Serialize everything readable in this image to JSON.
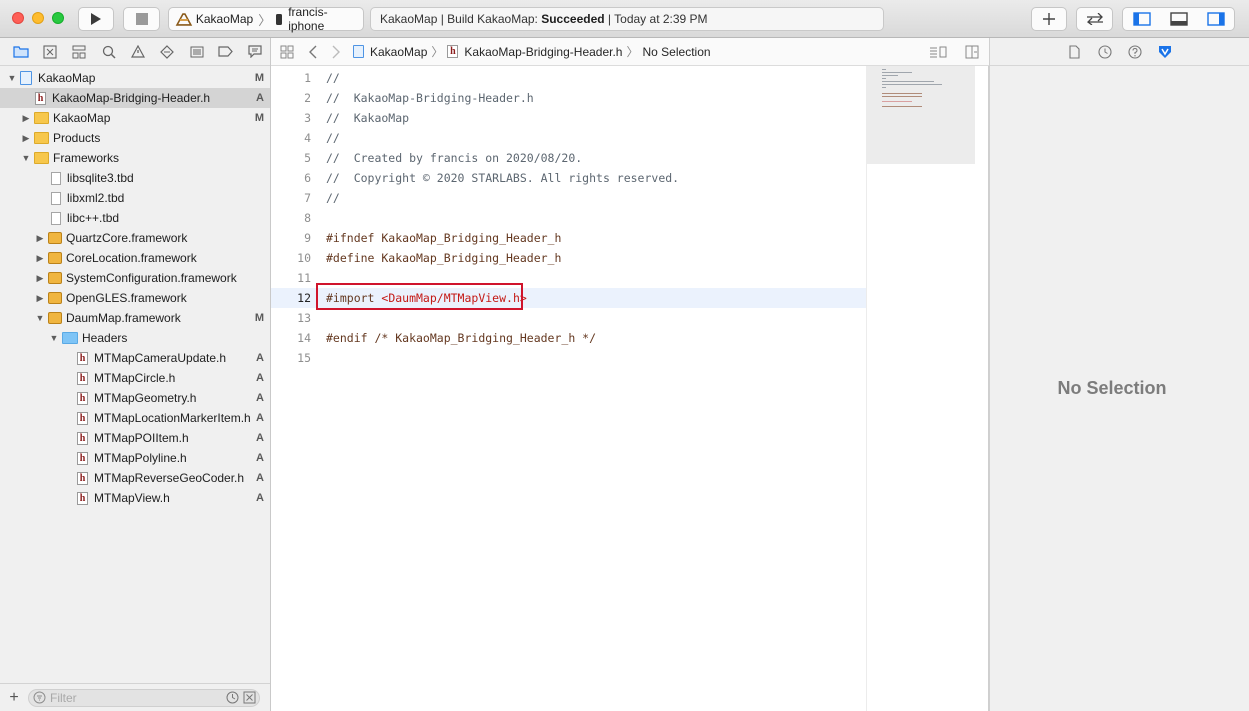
{
  "toolbar": {
    "scheme_project": "KakaoMap",
    "scheme_device": "francis-iphone",
    "activity_prefix": "KakaoMap | Build KakaoMap: ",
    "activity_status": "Succeeded",
    "activity_time": " | Today at 2:39 PM"
  },
  "navigator": {
    "tree": [
      {
        "label": "KakaoMap",
        "status": "M",
        "icon": "project-icon"
      },
      {
        "label": "KakaoMap-Bridging-Header.h",
        "status": "A",
        "icon": "header-file-icon"
      },
      {
        "label": "KakaoMap",
        "status": "M",
        "icon": "folder-icon"
      },
      {
        "label": "Products",
        "status": "",
        "icon": "folder-icon"
      },
      {
        "label": "Frameworks",
        "status": "",
        "icon": "folder-icon"
      },
      {
        "label": "libsqlite3.tbd",
        "status": "",
        "icon": "file-icon"
      },
      {
        "label": "libxml2.tbd",
        "status": "",
        "icon": "file-icon"
      },
      {
        "label": "libc++.tbd",
        "status": "",
        "icon": "file-icon"
      },
      {
        "label": "QuartzCore.framework",
        "status": "",
        "icon": "framework-icon"
      },
      {
        "label": "CoreLocation.framework",
        "status": "",
        "icon": "framework-icon"
      },
      {
        "label": "SystemConfiguration.framework",
        "status": "",
        "icon": "framework-icon"
      },
      {
        "label": "OpenGLES.framework",
        "status": "",
        "icon": "framework-icon"
      },
      {
        "label": "DaumMap.framework",
        "status": "M",
        "icon": "framework-icon"
      },
      {
        "label": "Headers",
        "status": "",
        "icon": "folder-blue-icon"
      },
      {
        "label": "MTMapCameraUpdate.h",
        "status": "A",
        "icon": "header-file-icon"
      },
      {
        "label": "MTMapCircle.h",
        "status": "A",
        "icon": "header-file-icon"
      },
      {
        "label": "MTMapGeometry.h",
        "status": "A",
        "icon": "header-file-icon"
      },
      {
        "label": "MTMapLocationMarkerItem.h",
        "status": "A",
        "icon": "header-file-icon"
      },
      {
        "label": "MTMapPOIItem.h",
        "status": "A",
        "icon": "header-file-icon"
      },
      {
        "label": "MTMapPolyline.h",
        "status": "A",
        "icon": "header-file-icon"
      },
      {
        "label": "MTMapReverseGeoCoder.h",
        "status": "A",
        "icon": "header-file-icon"
      },
      {
        "label": "MTMapView.h",
        "status": "A",
        "icon": "header-file-icon"
      }
    ],
    "filter_placeholder": "Filter"
  },
  "jumpbar": {
    "crumb_project": "KakaoMap",
    "crumb_file": "KakaoMap-Bridging-Header.h",
    "crumb_selection": "No Selection"
  },
  "editor": {
    "current_line": 12,
    "lines": [
      {
        "n": "1",
        "text": "//"
      },
      {
        "n": "2",
        "text": "//  KakaoMap-Bridging-Header.h"
      },
      {
        "n": "3",
        "text": "//  KakaoMap"
      },
      {
        "n": "4",
        "text": "//"
      },
      {
        "n": "5",
        "text": "//  Created by francis on 2020/08/20."
      },
      {
        "n": "6",
        "text": "//  Copyright © 2020 STARLABS. All rights reserved."
      },
      {
        "n": "7",
        "text": "//"
      },
      {
        "n": "8",
        "text": ""
      },
      {
        "n": "9",
        "text": "#ifndef KakaoMap_Bridging_Header_h"
      },
      {
        "n": "10",
        "text": "#define KakaoMap_Bridging_Header_h"
      },
      {
        "n": "11",
        "text": ""
      },
      {
        "n": "12",
        "text": "#import ",
        "str": "<DaumMap/MTMapView.h>"
      },
      {
        "n": "13",
        "text": ""
      },
      {
        "n": "14",
        "text": "#endif /* KakaoMap_Bridging_Header_h */"
      },
      {
        "n": "15",
        "text": ""
      }
    ]
  },
  "inspector": {
    "empty_text": "No Selection"
  },
  "colors": {
    "accent": "#1a73e8",
    "highlight_box": "#d0142c",
    "string": "#c41a16",
    "preprocessor": "#643820",
    "comment": "#5c6670"
  }
}
